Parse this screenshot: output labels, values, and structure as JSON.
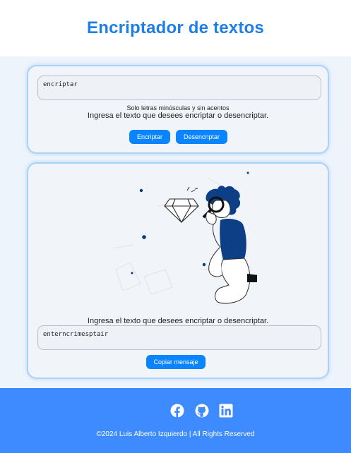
{
  "header": {
    "title": "Encriptador de textos"
  },
  "input_card": {
    "input_value": "encriptar",
    "hint": "Solo letras minúsculas y sin acentos",
    "instruction": "Ingresa el texto que desees encriptar o desencriptar.",
    "encrypt_label": "Encriptar",
    "decrypt_label": "Desencriptar"
  },
  "output_card": {
    "instruction": "Ingresa el texto que desees encriptar o desencriptar.",
    "output_value": "enterncrimesptair",
    "copy_label": "Copiar mensaje"
  },
  "footer": {
    "icons": [
      "facebook-icon",
      "github-icon",
      "linkedin-icon"
    ],
    "copyright": "©2024 Luis Alberto Izquierdo | All Rights Reserved"
  },
  "colors": {
    "accent": "#1e7ee8",
    "button": "#0a84ff",
    "footer": "#3d8bff",
    "card_border": "#a9d3f7"
  }
}
